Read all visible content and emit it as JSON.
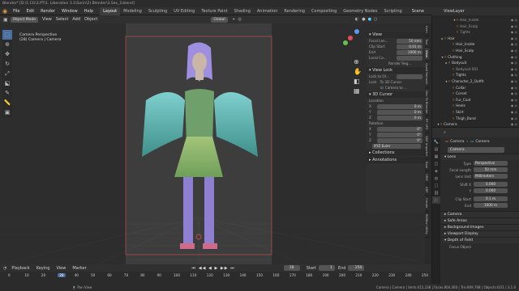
{
  "window_title": "Blender* [D:\\1.CG\\3.PT\\1. Liberation 3.1\\Sorin\\2) Blender\\3.Ses_3.blend]",
  "menu": [
    "File",
    "Edit",
    "Render",
    "Window",
    "Help"
  ],
  "workspaces": [
    "Layout",
    "Modeling",
    "Sculpting",
    "UV Editing",
    "Texture Paint",
    "Shading",
    "Animation",
    "Rendering",
    "Compositing",
    "Geometry Nodes",
    "Scripting"
  ],
  "active_workspace": "Layout",
  "scene_label": "Scene",
  "viewlayer_label": "ViewLayer",
  "viewport_header": {
    "mode": "Object Mode",
    "view": "View",
    "select": "Select",
    "add": "Add",
    "object": "Object",
    "orientation": "Global",
    "options": "Options"
  },
  "viewport_info": {
    "line1": "Camera Perspective",
    "line2": "(28) Camera | Camera"
  },
  "npanel": {
    "view_title": "View",
    "focal_label": "Focal Len...",
    "focal_value": "50 mm",
    "clip_label": "Clip Start",
    "clip_start": "0.01 m",
    "end_label": "End",
    "clip_end": "1000 m",
    "local_cam_label": "Local Ca...",
    "render_region": "Render Reg...",
    "view_lock_title": "View Lock",
    "lock_to_obj": "Lock to Ol...",
    "lock_label": "Lock",
    "to_3d_cursor": "To 3D Cursor",
    "camera_to_view": "Camera to ...",
    "cursor_title": "3D Cursor",
    "location_label": "Location",
    "x_label": "X",
    "y_label": "Y",
    "z_label": "Z",
    "loc_x": "0 m",
    "loc_y": "0 m",
    "loc_z": "0 m",
    "rotation_label": "Rotation",
    "rot_x": "0°",
    "rot_y": "0°",
    "rot_z": "0°",
    "rot_mode": "XYZ Euler",
    "collections": "Collections",
    "annotations": "Annotations"
  },
  "vtabs": [
    "Item",
    "Tool",
    "View",
    "Quad Remesh",
    "Dev To Blender",
    "RT UPS",
    "SBZ Importer",
    "Bool",
    "VRM",
    "ARP",
    "Create",
    "BOBbv Utility"
  ],
  "outliner": [
    {
      "indent": 5,
      "icon": "▾",
      "label": "Hair_Inside",
      "color": "#999"
    },
    {
      "indent": 5,
      "icon": "",
      "label": "Hair_Scalp",
      "color": "#999"
    },
    {
      "indent": 5,
      "icon": "",
      "label": "Tights",
      "color": "#999"
    },
    {
      "indent": 2,
      "icon": "▸",
      "label": "Hair",
      "color": "#ccc"
    },
    {
      "indent": 4,
      "icon": "",
      "label": "Hair_Inside",
      "color": "#ccc"
    },
    {
      "indent": 4,
      "icon": "",
      "label": "Hair_Scalp",
      "color": "#ccc"
    },
    {
      "indent": 2,
      "icon": "▾",
      "label": "Clothing",
      "color": "#ccc"
    },
    {
      "indent": 3,
      "icon": "▸",
      "label": "Bodysuit",
      "color": "#ccc"
    },
    {
      "indent": 4,
      "icon": "",
      "label": "Bodysuit.001",
      "color": "#999"
    },
    {
      "indent": 4,
      "icon": "",
      "label": "Tights",
      "color": "#ccc"
    },
    {
      "indent": 3,
      "icon": "▾",
      "label": "Character_2_Outfit",
      "color": "#ccc"
    },
    {
      "indent": 4,
      "icon": "",
      "label": "Collar",
      "color": "#ccc"
    },
    {
      "indent": 4,
      "icon": "",
      "label": "Corset",
      "color": "#ccc"
    },
    {
      "indent": 4,
      "icon": "",
      "label": "Fur_Coat",
      "color": "#ccc"
    },
    {
      "indent": 4,
      "icon": "",
      "label": "Heels",
      "color": "#ccc"
    },
    {
      "indent": 4,
      "icon": "",
      "label": "Skirt",
      "color": "#ccc"
    },
    {
      "indent": 4,
      "icon": "",
      "label": "Thigh_Band",
      "color": "#ccc"
    },
    {
      "indent": 1,
      "icon": "▾",
      "label": "Camera",
      "color": "#ccc"
    },
    {
      "indent": 2,
      "icon": "",
      "label": "Camera",
      "color": "#fff",
      "selected": true
    }
  ],
  "props": {
    "camera_label": "Camera",
    "camera_sub": "Camera",
    "data_name": "Camera",
    "lens_title": "Lens",
    "type_label": "Type",
    "type_value": "Perspective",
    "focal_label": "Focal Length",
    "focal_value": "50 mm",
    "lens_unit_label": "Lens Unit",
    "lens_unit_value": "Millimeters",
    "shift_x_label": "Shift X",
    "shift_x": "0.000",
    "shift_y_label": "Y",
    "shift_y": "0.000",
    "clip_start_label": "Clip Start",
    "clip_start": "0.1 m",
    "clip_end_label": "End",
    "clip_end": "1000 m",
    "sections": [
      "Camera",
      "Safe Areas",
      "Background Images",
      "Viewport Display",
      "Depth of Field",
      "Focus Object"
    ]
  },
  "timeline": {
    "playback": "Playback",
    "keying": "Keying",
    "view": "View",
    "marker": "Marker",
    "current_frame": "28",
    "start_label": "Start",
    "start": "1",
    "end_label": "End",
    "end": "250",
    "ticks": [
      "0",
      "10",
      "20",
      "28",
      "40",
      "50",
      "60",
      "70",
      "80",
      "90",
      "100",
      "110",
      "120",
      "130",
      "140",
      "150",
      "160",
      "170",
      "180",
      "190",
      "200",
      "210",
      "220",
      "230",
      "240",
      "250"
    ]
  },
  "status": {
    "left": "Pan View",
    "right": "Camera | Camera | Verts:415,238 | Faces:804,360 | Tris:809,708 | Objects:0/21 | 3.1.0"
  },
  "colors": {
    "accent": "#4a6fa0",
    "selected_row": "#3f5f8a",
    "orange": "#e89a3a"
  }
}
